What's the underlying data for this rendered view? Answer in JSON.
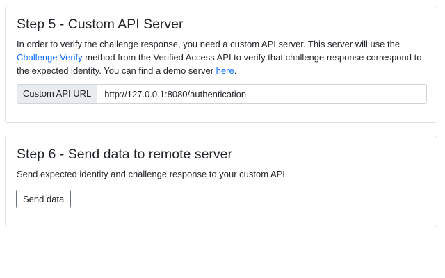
{
  "step5": {
    "title": "Step 5 - Custom API Server",
    "text_1": "In order to verify the challenge response, you need a custom API server. This server will use the ",
    "link_challenge_verify": "Challenge Verify",
    "text_2": " method from the Verified Access API to verify that challenge response correspond to the expected identity. You can find a demo server ",
    "link_here": "here",
    "text_3": ".",
    "input_label": "Custom API URL",
    "input_value": "http://127.0.0.1:8080/authentication"
  },
  "step6": {
    "title": "Step 6 - Send data to remote server",
    "text": "Send expected identity and challenge response to your custom API.",
    "button_label": "Send data"
  }
}
